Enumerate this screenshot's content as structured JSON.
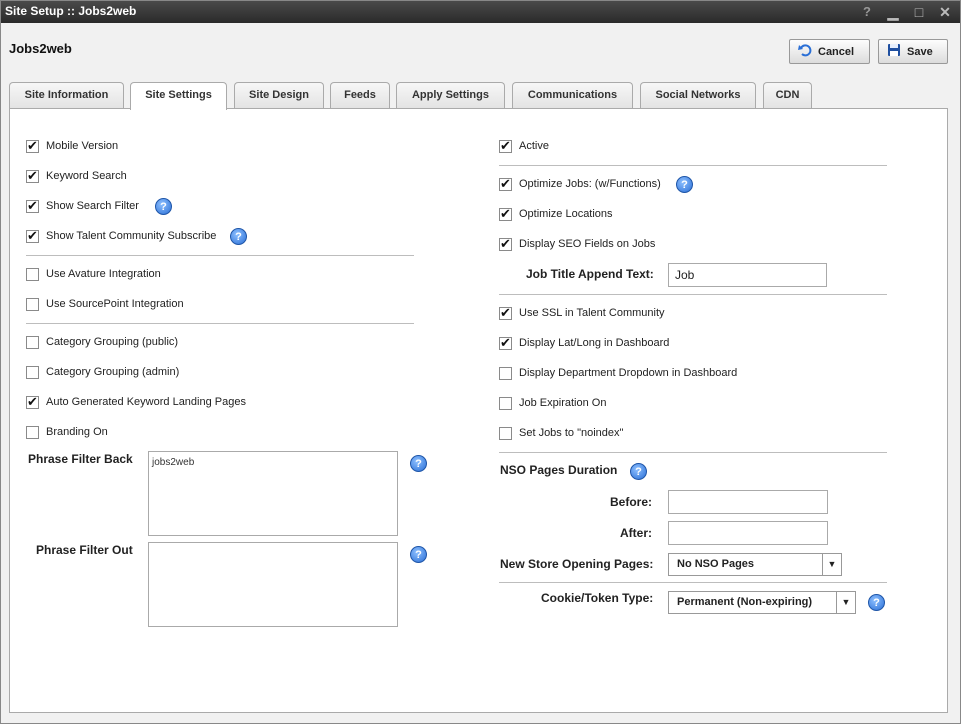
{
  "window": {
    "title": "Site Setup :: Jobs2web",
    "help": "?",
    "minimize": "▁",
    "maximize": "□",
    "close": "✕"
  },
  "app_title": "Jobs2web",
  "actions": {
    "cancel": "Cancel",
    "save": "Save"
  },
  "tabs": [
    "Site Information",
    "Site Settings",
    "Site Design",
    "Feeds",
    "Apply Settings",
    "Communications",
    "Social Networks",
    "CDN"
  ],
  "active_tab": "Site Settings",
  "left": {
    "checkboxes": [
      {
        "label": "Mobile Version",
        "checked": true
      },
      {
        "label": "Keyword Search",
        "checked": true
      },
      {
        "label": "Show Search Filter",
        "checked": true
      },
      {
        "label": "Show Talent Community Subscribe",
        "checked": true
      },
      {
        "label": "Use Avature Integration",
        "checked": false
      },
      {
        "label": "Use SourcePoint Integration",
        "checked": false
      },
      {
        "label": "Category Grouping (public)",
        "checked": false
      },
      {
        "label": "Category Grouping (admin)",
        "checked": false
      },
      {
        "label": "Auto Generated Keyword Landing Pages",
        "checked": true
      },
      {
        "label": "Branding On",
        "checked": false
      }
    ],
    "phrase_filter_back": {
      "label": "Phrase Filter Back",
      "value": "jobs2web"
    },
    "phrase_filter_out": {
      "label": "Phrase Filter Out",
      "value": ""
    }
  },
  "right": {
    "checkboxes": [
      {
        "label": "Active",
        "checked": true
      },
      {
        "label": "Optimize Jobs: (w/Functions)",
        "checked": true
      },
      {
        "label": "Optimize Locations",
        "checked": true
      },
      {
        "label": "Display SEO Fields on Jobs",
        "checked": true
      },
      {
        "label": "Use SSL in Talent Community",
        "checked": true
      },
      {
        "label": "Display Lat/Long in Dashboard",
        "checked": true
      },
      {
        "label": "Display Department Dropdown in Dashboard",
        "checked": false
      },
      {
        "label": "Job Expiration On",
        "checked": false
      },
      {
        "label": "Set Jobs to \"noindex\"",
        "checked": false
      }
    ],
    "job_title_append": {
      "label": "Job Title Append Text:",
      "value": "Job"
    },
    "nso": {
      "heading": "NSO Pages Duration",
      "before_label": "Before:",
      "before_value": "",
      "after_label": "After:",
      "after_value": "",
      "pages_label": "New Store Opening Pages:",
      "pages_value": "No NSO Pages"
    },
    "cookie": {
      "label": "Cookie/Token Type:",
      "value": "Permanent (Non-expiring)"
    }
  },
  "colors": {
    "titlebar": "#333333",
    "help_icon": "#2a6fd6"
  }
}
